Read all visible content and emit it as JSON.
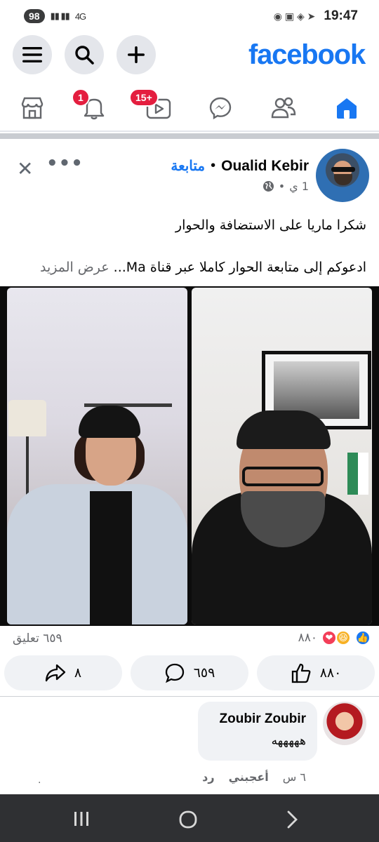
{
  "status_bar": {
    "battery": "98",
    "network": "4G",
    "time": "19:47"
  },
  "header": {
    "logo": "facebook",
    "icons": [
      "menu-icon",
      "search-icon",
      "plus-icon"
    ]
  },
  "tabs": [
    {
      "name": "home",
      "icon": "home-icon",
      "active": true
    },
    {
      "name": "friends",
      "icon": "friends-icon"
    },
    {
      "name": "messenger",
      "icon": "messenger-icon"
    },
    {
      "name": "video",
      "icon": "video-icon",
      "badge": "15+"
    },
    {
      "name": "notifications",
      "icon": "bell-icon",
      "badge": "1"
    },
    {
      "name": "marketplace",
      "icon": "marketplace-icon"
    }
  ],
  "post": {
    "author": "Oualid Kebir",
    "follow_label": "متابعة",
    "time": "1 ي",
    "text_line1": "شكرا ماريا على الاستضافة والحوار",
    "text_line2": "ادعوكم إلى متابعة الحوار كاملا عبر قناة Ma...",
    "see_more": "عرض المزيد",
    "reaction_count": "٨٨٠",
    "comment_count": "٦٥٩ تعليق",
    "actions": {
      "like": "٨٨٠",
      "comment": "٦٥٩",
      "share": "٨"
    }
  },
  "comment": {
    "author": "Zoubir Zoubir",
    "text": "هههههه",
    "time": "٦ س",
    "like_label": "أعجبني",
    "reply_label": "رد"
  },
  "colors": {
    "brand": "#1877f2",
    "badge": "#e41e3f",
    "muted": "#65676b"
  }
}
